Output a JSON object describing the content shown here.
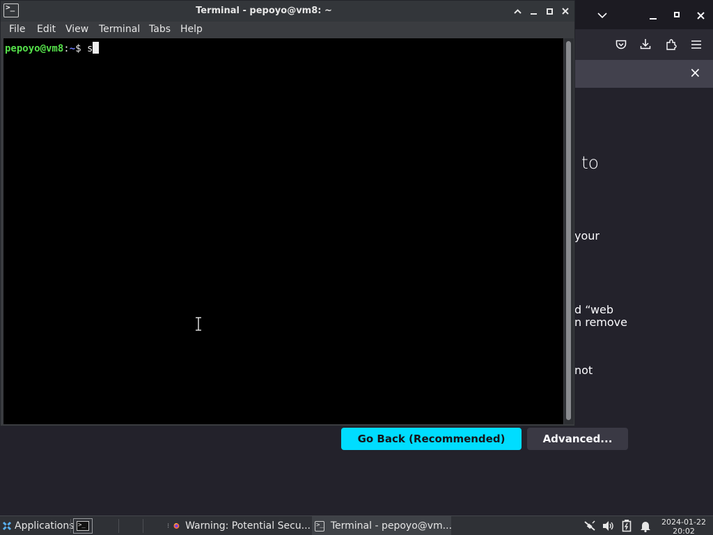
{
  "browser": {
    "notification_close": "×",
    "heading_fragment": "g to",
    "para_fragments": [
      "your",
      "d “web",
      "n remove",
      "not"
    ],
    "buttons": {
      "go_back": "Go Back (Recommended)",
      "advanced": "Advanced..."
    },
    "colors": {
      "primary_button": "#00ddff",
      "page_bg": "#23222b"
    }
  },
  "terminal": {
    "title": "Terminal - pepoyo@vm8: ~",
    "menu": [
      "File",
      "Edit",
      "View",
      "Terminal",
      "Tabs",
      "Help"
    ],
    "prompt": {
      "user_host": "pepoyo@vm8",
      "sep": ":",
      "path": "~",
      "symbol": "$",
      "input": "s"
    },
    "icons": {
      "app": "terminal-icon",
      "window_controls": [
        "shade-up-icon",
        "minimize-icon",
        "maximize-icon",
        "close-icon"
      ]
    }
  },
  "taskbar": {
    "applications_label": "Applications",
    "windows": [
      {
        "label": "Warning: Potential Secu...",
        "icon": "firefox-icon"
      },
      {
        "label": "Terminal - pepoyo@vm...",
        "icon": "terminal-icon"
      }
    ],
    "clock": {
      "date": "2024-01-22",
      "time": "20:02"
    }
  }
}
